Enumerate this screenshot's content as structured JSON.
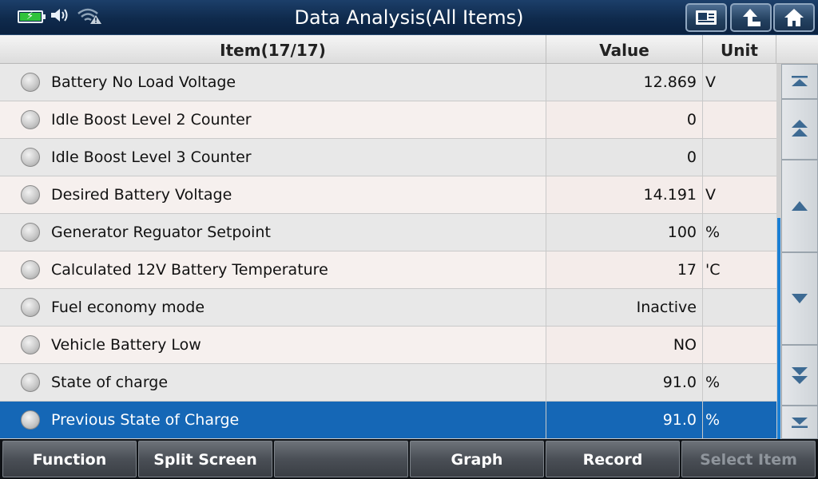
{
  "status": {
    "battery_icon": "battery-charging-icon",
    "speaker_icon": "speaker-icon",
    "wifi_icon": "wifi-warning-icon"
  },
  "title": "Data Analysis(All Items)",
  "toolbar": {
    "buttons": [
      {
        "name": "report-button",
        "icon": "report-icon"
      },
      {
        "name": "back-button",
        "icon": "up-arrow-icon"
      },
      {
        "name": "home-button",
        "icon": "home-icon"
      }
    ]
  },
  "table": {
    "headers": {
      "item": "Item(17/17)",
      "value": "Value",
      "unit": "Unit"
    },
    "rows": [
      {
        "label": "Battery No Load Voltage",
        "value": "12.869",
        "unit": "V"
      },
      {
        "label": "Idle Boost Level 2 Counter",
        "value": "0",
        "unit": ""
      },
      {
        "label": "Idle Boost Level 3 Counter",
        "value": "0",
        "unit": ""
      },
      {
        "label": "Desired Battery Voltage",
        "value": "14.191",
        "unit": "V"
      },
      {
        "label": "Generator Reguator Setpoint",
        "value": "100",
        "unit": "%"
      },
      {
        "label": "Calculated 12V Battery Temperature",
        "value": "17",
        "unit": "'C"
      },
      {
        "label": "Fuel economy mode",
        "value": "Inactive",
        "unit": ""
      },
      {
        "label": "Vehicle Battery Low",
        "value": "NO",
        "unit": ""
      },
      {
        "label": "State of charge",
        "value": "91.0",
        "unit": "%"
      },
      {
        "label": "Previous State of Charge",
        "value": "91.0",
        "unit": "%"
      }
    ],
    "selected_index": 9
  },
  "scrollbar": {
    "buttons": [
      "scroll-top-icon",
      "page-up-icon",
      "line-up-icon",
      "line-down-icon",
      "page-down-icon",
      "scroll-bottom-icon"
    ]
  },
  "functions": [
    "Function",
    "Split Screen",
    "",
    "Graph",
    "Record",
    "Select Item"
  ],
  "colors": {
    "selected_row": "#1567b6",
    "title_bar": "#0f2a4c",
    "scroll_thumb": "#1a7fd4"
  }
}
